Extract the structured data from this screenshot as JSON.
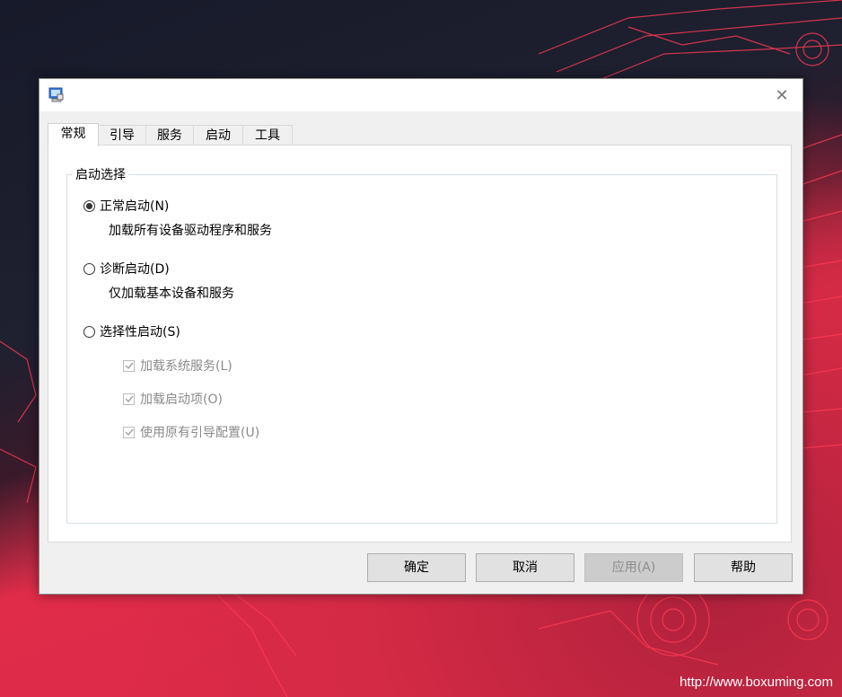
{
  "window": {
    "title": "",
    "close_glyph": "✕"
  },
  "tabs": [
    {
      "label": "常规",
      "active": true
    },
    {
      "label": "引导",
      "active": false
    },
    {
      "label": "服务",
      "active": false
    },
    {
      "label": "启动",
      "active": false
    },
    {
      "label": "工具",
      "active": false
    }
  ],
  "startup_group": {
    "title": "启动选择",
    "normal": {
      "label": "正常启动(N)",
      "description": "加载所有设备驱动程序和服务",
      "selected": true
    },
    "diagnostic": {
      "label": "诊断启动(D)",
      "description": "仅加载基本设备和服务",
      "selected": false
    },
    "selective": {
      "label": "选择性启动(S)",
      "selected": false,
      "options": [
        {
          "label": "加载系统服务(L)",
          "checked": true,
          "enabled": false
        },
        {
          "label": "加载启动项(O)",
          "checked": true,
          "enabled": false
        },
        {
          "label": "使用原有引导配置(U)",
          "checked": true,
          "enabled": false
        }
      ]
    }
  },
  "buttons": {
    "ok": "确定",
    "cancel": "取消",
    "apply": "应用(A)",
    "help": "帮助"
  },
  "watermark": "http://www.boxuming.com",
  "colors": {
    "accent_red": "#e02c49",
    "dialog_bg": "#f0f0f0"
  }
}
